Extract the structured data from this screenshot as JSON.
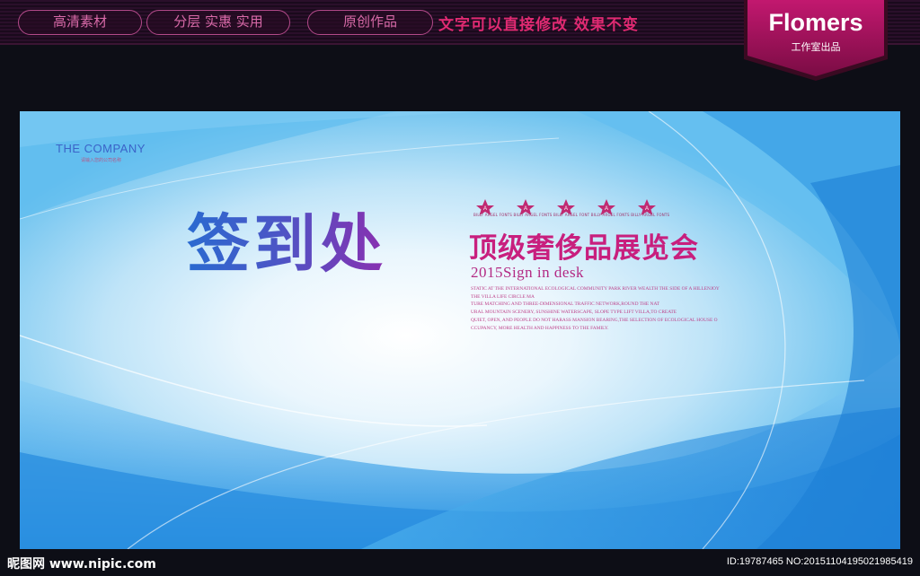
{
  "topbar": {
    "pills": [
      "高清素材",
      "分层 实惠 实用",
      "原创作品"
    ],
    "slogan": "文字可以直接修改  效果不变",
    "brand_name": "Flomers",
    "brand_sub": "工作室出品"
  },
  "art": {
    "company": "THE COMPANY",
    "company_sub": "请输入您的公司名称",
    "title": "签到处",
    "star_letters": [
      "A",
      "A",
      "A",
      "A",
      "A"
    ],
    "star_caption": "BILLY ARGEL FONTS BILLY ARGEL FONTS BILLY ARGEL FONT BILLY ARGEL FONTS BILLY ARGEL FONTS",
    "subtitle": "顶级奢侈品展览会",
    "sign": "2015Sign in desk",
    "blurb": [
      "STATIC AT THE INTERNATIONAL ECOLOGICAL COMMUNITY PARK RIVER WEALTH THE SIDE OF A HILLENJOY",
      "THE VILLA LIFE CIRCLE MA",
      "TURE MATCHING AND THREE-DIMENSIONAL TRAFFIC NETWORK,ROUND THE NAT",
      "URAL MOUNTAIN SCENERY, SUNSHINE WATERSCAPE, SLOPE TYPE LIFT VILLA,TO CREATE",
      "QUIET, OPEN, AND PEOPLE DO NOT HARASS MANSION BEARING,THE SELECTION OF ECOLOGICAL HOUSE O",
      "CCUPANCY, MORE HEALTH AND HAPPINESS TO THE FAMILY."
    ]
  },
  "watermark": {
    "logo": "昵图网 www.nipic.com",
    "id": "ID:19787465 NO:20151104195021985419"
  },
  "colors": {
    "accent_pink": "#e02a72",
    "title_blue": "#2a6ad0",
    "title_purple": "#8a2fb0",
    "subtitle_magenta": "#c81f7e"
  }
}
